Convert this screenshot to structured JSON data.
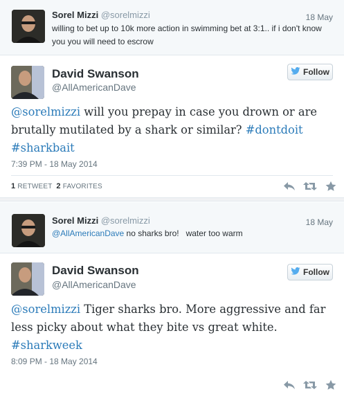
{
  "tweets": [
    {
      "name": "Sorel Mizzi",
      "handle": "@sorelmizzi",
      "date": "18 May",
      "line1": "willing to bet up to 10k more action in swimming bet at 3:1.. if i don't know",
      "line2": "you you will need to escrow"
    },
    {
      "name": "David Swanson",
      "handle": "@AllAmericanDave",
      "follow_label": "Follow",
      "text": {
        "mention": "@sorelmizzi",
        "body1": " will you prepay in case you drown or are",
        "body2": "brutally mutilated by a shark or similar? ",
        "tag1": "#dontdoit",
        "tag2": "#sharkbait"
      },
      "timestamp": "7:39 PM - 18 May 2014",
      "retweets": "1",
      "retweets_label": "RETWEET",
      "favorites": "2",
      "favorites_label": "FAVORITES"
    },
    {
      "name": "Sorel Mizzi",
      "handle": "@sorelmizzi",
      "date": "18 May",
      "mention": "@AllAmericanDave",
      "text": " no sharks bro!   water too warm"
    },
    {
      "name": "David Swanson",
      "handle": "@AllAmericanDave",
      "follow_label": "Follow",
      "text": {
        "mention": "@sorelmizzi",
        "body1": " Tiger sharks bro. More aggressive and far",
        "body2": "less picky about what they bite vs great white.",
        "tag1": "#sharkweek"
      },
      "timestamp": "8:09 PM - 18 May 2014"
    }
  ],
  "icons": [
    "reply-icon",
    "retweet-icon",
    "favorite-icon",
    "twitter-bird-icon"
  ],
  "colors": {
    "link": "#2b7bb9",
    "muted": "#66757f",
    "action": "#8899a6"
  }
}
